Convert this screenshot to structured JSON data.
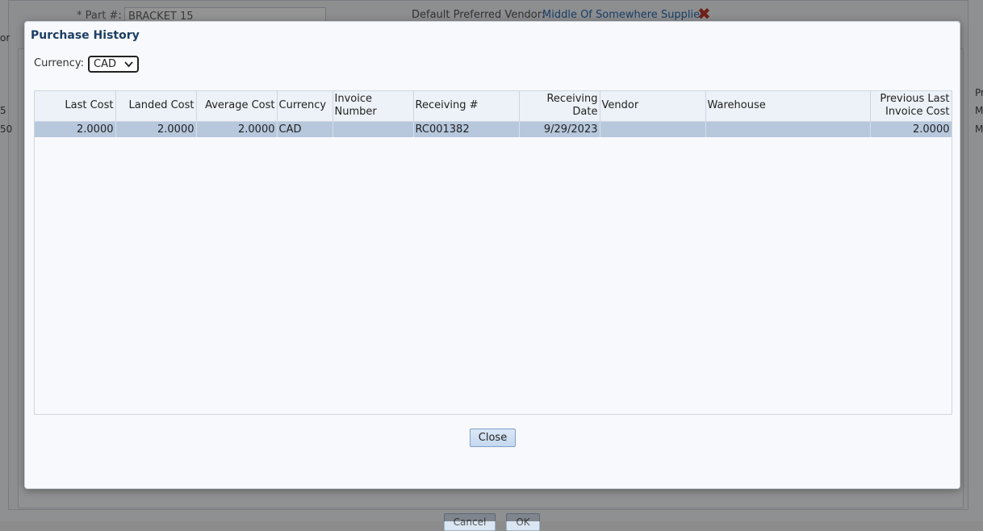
{
  "background": {
    "part_label": "* Part #:",
    "part_value": "BRACKET 15",
    "vendor_label": "Default Preferred Vendor:",
    "vendor_link": "Middle Of Somewhere Supplier",
    "left_fragments": [
      "or",
      "5",
      "50"
    ],
    "right_fragments": [
      "Pr",
      "M",
      "M"
    ],
    "cancel_label": "Cancel",
    "ok_label": "OK",
    "remove_icon": "close-x-icon"
  },
  "modal": {
    "title": "Purchase History",
    "currency_label": "Currency:",
    "currency_value": "CAD",
    "close_label": "Close"
  },
  "table": {
    "headers": {
      "last_cost": "Last Cost",
      "landed_cost": "Landed Cost",
      "average_cost": "Average Cost",
      "currency": "Currency",
      "invoice_number_1": "Invoice",
      "invoice_number_2": "Number",
      "receiving_no": "Receiving #",
      "receiving_date": "Receiving Date",
      "vendor": "Vendor",
      "warehouse": "Warehouse",
      "prev_last_invoice_1": "Previous Last",
      "prev_last_invoice_2": "Invoice Cost"
    },
    "rows": [
      {
        "last_cost": "2.0000",
        "landed_cost": "2.0000",
        "average_cost": "2.0000",
        "currency": "CAD",
        "invoice_number": "",
        "receiving_no": "RC001382",
        "receiving_date": "9/29/2023",
        "vendor": "",
        "warehouse": "",
        "prev_last_invoice_cost": "2.0000"
      }
    ]
  },
  "colors": {
    "selected_row": "#b7c8dd",
    "header_bg": "#edf1f8",
    "title": "#1c3e63"
  }
}
